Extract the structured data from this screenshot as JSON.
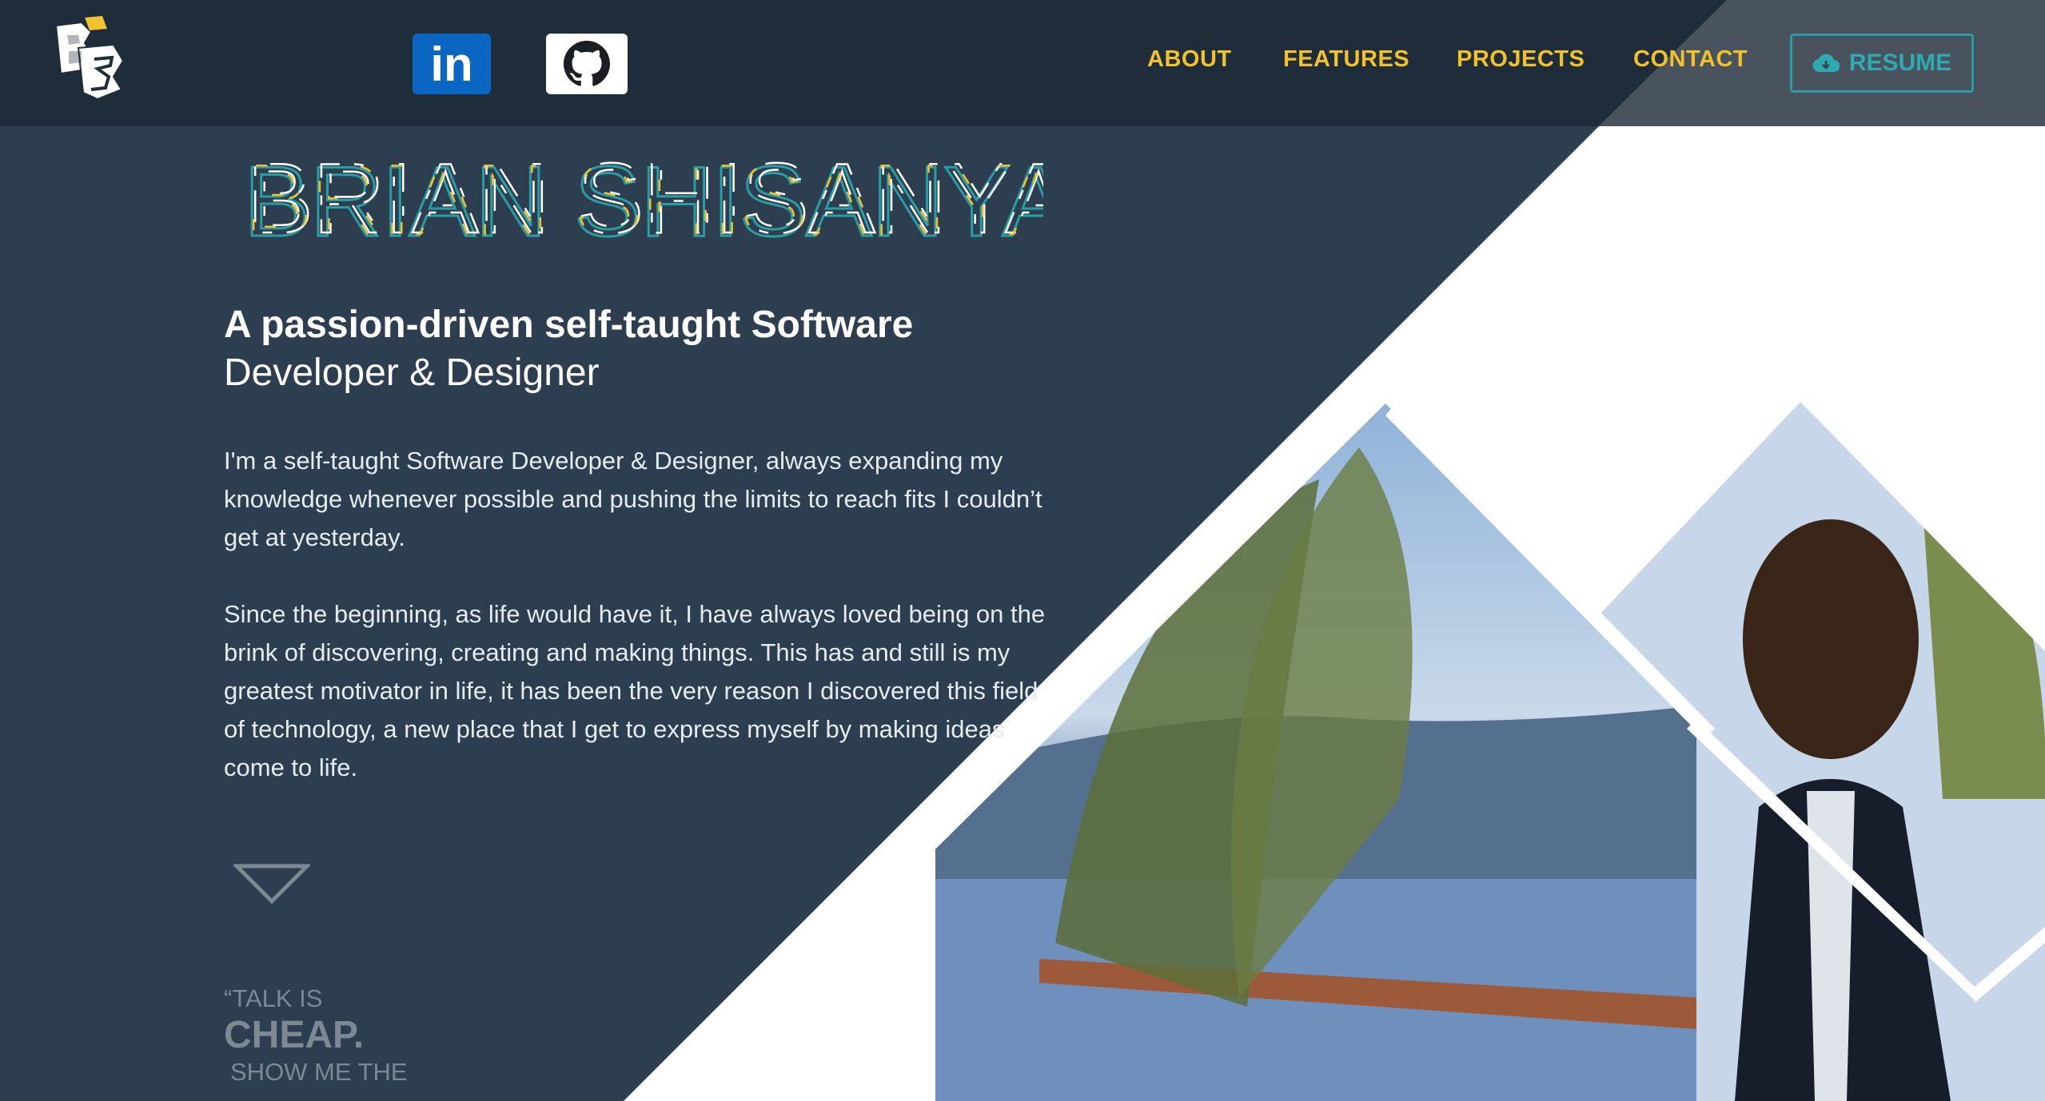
{
  "brand": {
    "logo_alt": "BS"
  },
  "social": {
    "linkedin_label": "in",
    "github_icon": "github-icon"
  },
  "nav": {
    "items": [
      {
        "label": "ABOUT"
      },
      {
        "label": "FEATURES"
      },
      {
        "label": "PROJECTS"
      },
      {
        "label": "CONTACT"
      }
    ],
    "resume_label": "RESUME"
  },
  "hero": {
    "name": "BRIAN SHISANYA",
    "headline_bold": "A passion-driven self-taught Software",
    "headline_rest": "Developer & Designer",
    "paragraph1": "I'm a self-taught Software Developer & Designer, always expanding my knowledge whenever possible and pushing the limits to reach fits I couldn’t get at yesterday.",
    "paragraph2": "Since the beginning, as life would have it, I have always loved being on the brink of discovering, creating and making things. This has and still is my greatest motivator in life, it has been the very reason I discovered this field of technology, a new place that I get to express myself by making ideas come to life."
  },
  "quote": {
    "line1": "“TALK IS",
    "line2": "CHEAP.",
    "line3": "SHOW ME THE"
  },
  "colors": {
    "dark_bg": "#2c3e50",
    "nav_bg": "#1f2c3a",
    "accent_yellow": "#f2c12e",
    "accent_teal": "#2a9ca3"
  }
}
